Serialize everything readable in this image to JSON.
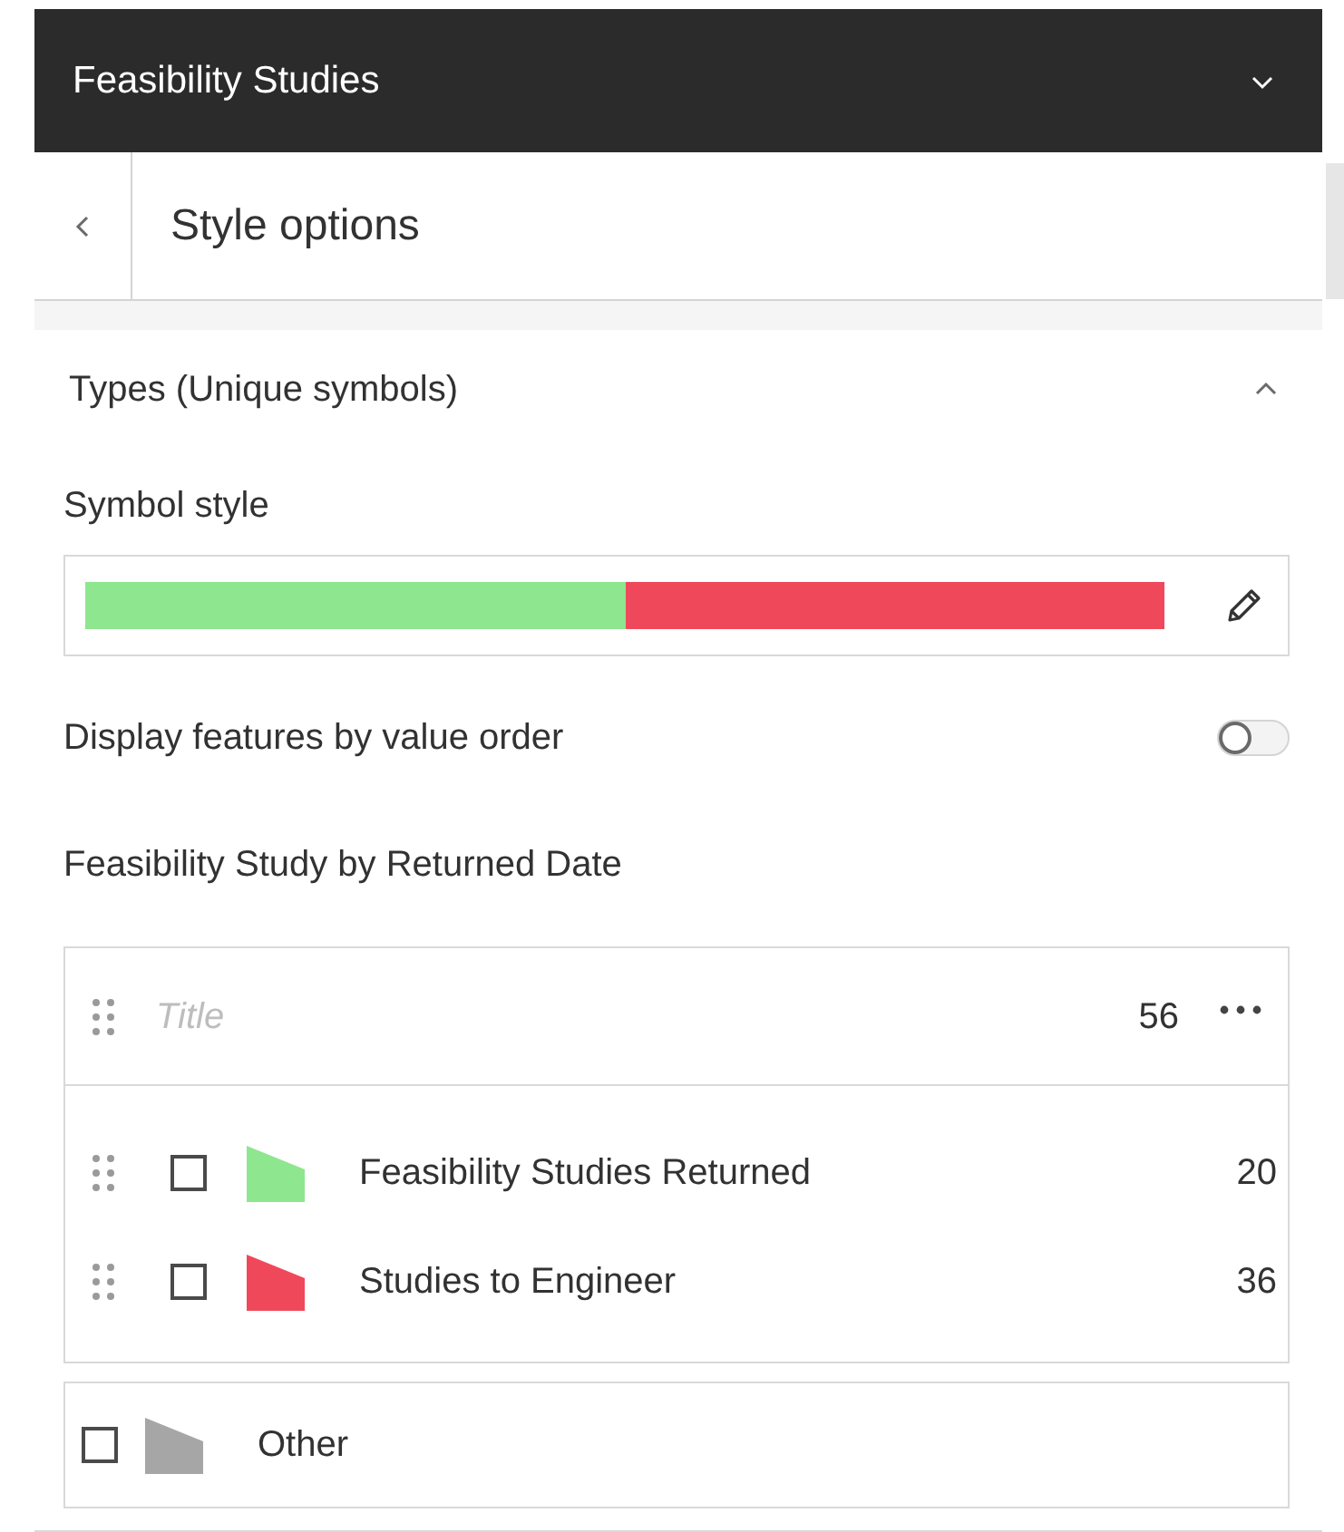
{
  "header": {
    "title": "Feasibility Studies",
    "expanded": false
  },
  "panel": {
    "title": "Style options"
  },
  "section": {
    "title": "Types (Unique symbols)",
    "expanded": true
  },
  "symbol_style": {
    "label": "Symbol style",
    "ramp": [
      {
        "color": "#8ee68f"
      },
      {
        "color": "#f0485b"
      }
    ]
  },
  "value_order": {
    "label": "Display features by value order",
    "on": false
  },
  "legend": {
    "field_label": "Feasibility Study by Returned Date",
    "title_placeholder": "Title",
    "total": "56",
    "items": [
      {
        "label": "Feasibility Studies Returned",
        "count": "20",
        "color": "#8ee68f",
        "checked": false
      },
      {
        "label": "Studies to Engineer",
        "count": "36",
        "color": "#f0485b",
        "checked": false
      }
    ],
    "other": {
      "label": "Other",
      "color": "#a6a6a6",
      "checked": false
    }
  }
}
